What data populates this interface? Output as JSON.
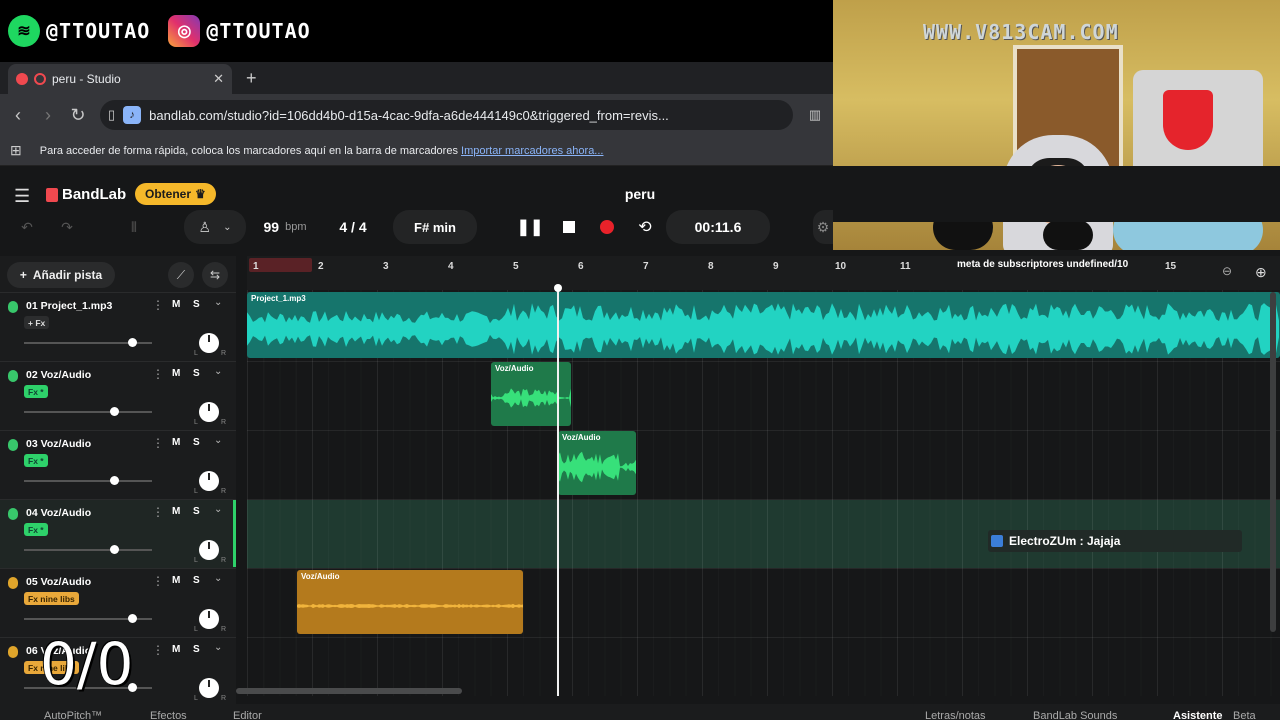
{
  "social": {
    "spotify_handle": "@TTOUTAO",
    "instagram_handle": "@TTOUTAO"
  },
  "browser": {
    "tab_title": "peru - Studio",
    "tab_close": "✕",
    "new_tab": "+",
    "url": "bandlab.com/studio?id=106dd4b0-d15a-4cac-9dfa-a6de444149c0&triggered_from=revis...",
    "bookmarks_text": "Para acceder de forma rápida, coloca los marcadores aquí en la barra de marcadores",
    "bookmarks_link": "Importar marcadores ahora..."
  },
  "webcam": {
    "watermark": "WWW.V813CAM.COM"
  },
  "app": {
    "brand": "BandLab",
    "get_label": "Obtener",
    "project_title": "peru"
  },
  "transport": {
    "tempo": "99",
    "tempo_unit": "bpm",
    "time_signature": "4 / 4",
    "key": "F# min",
    "time": "00:11.6"
  },
  "tracks_panel": {
    "add_track": "Añadir pista"
  },
  "tracks": [
    {
      "name": "01  Project_1.mp3",
      "fx": "+ Fx",
      "fx_style": "plain",
      "mic": "green",
      "vol": 0.84
    },
    {
      "name": "02  Voz/Audio",
      "fx": "Fx  *",
      "fx_style": "green",
      "mic": "green",
      "vol": 0.7
    },
    {
      "name": "03  Voz/Audio",
      "fx": "Fx  *",
      "fx_style": "green",
      "mic": "green",
      "vol": 0.7
    },
    {
      "name": "04  Voz/Audio",
      "fx": "Fx  *",
      "fx_style": "green",
      "mic": "green",
      "vol": 0.7
    },
    {
      "name": "05  Voz/Audio",
      "fx": "Fx  nine libs",
      "fx_style": "orange",
      "mic": "orange",
      "vol": 0.84
    },
    {
      "name": "06  Voz/Audio",
      "fx": "Fx  nine libs",
      "fx_style": "orange",
      "mic": "orange",
      "vol": 0.84
    }
  ],
  "track_buttons": {
    "mute": "M",
    "solo": "S"
  },
  "ruler": {
    "bars": [
      "1",
      "2",
      "3",
      "4",
      "5",
      "6",
      "7",
      "8",
      "9",
      "10",
      "11",
      "15"
    ],
    "ticker": "meta de subscriptores undefined/10"
  },
  "clips": [
    {
      "title": "Project_1.mp3"
    },
    {
      "title": "Voz/Audio"
    },
    {
      "title": "Voz/Audio"
    },
    {
      "title": "Voz/Audio"
    }
  ],
  "chat": {
    "message": "ElectroZUm : Jajaja"
  },
  "overlay_counter": "0/0",
  "bottom_bar": {
    "autopitch": "AutoPitch™",
    "effects": "Efectos",
    "editor": "Editor",
    "lyrics": "Letras/notas",
    "sounds": "BandLab Sounds",
    "assistant": "Asistente",
    "beta": "Beta"
  },
  "colors": {
    "accent_green": "#2ed16a",
    "teal_clip": "#1fb9a7",
    "orange_clip": "#e9a83a",
    "record_red": "#e8222a",
    "brand_red": "#f0494f",
    "get_yellow": "#f5b82a"
  }
}
